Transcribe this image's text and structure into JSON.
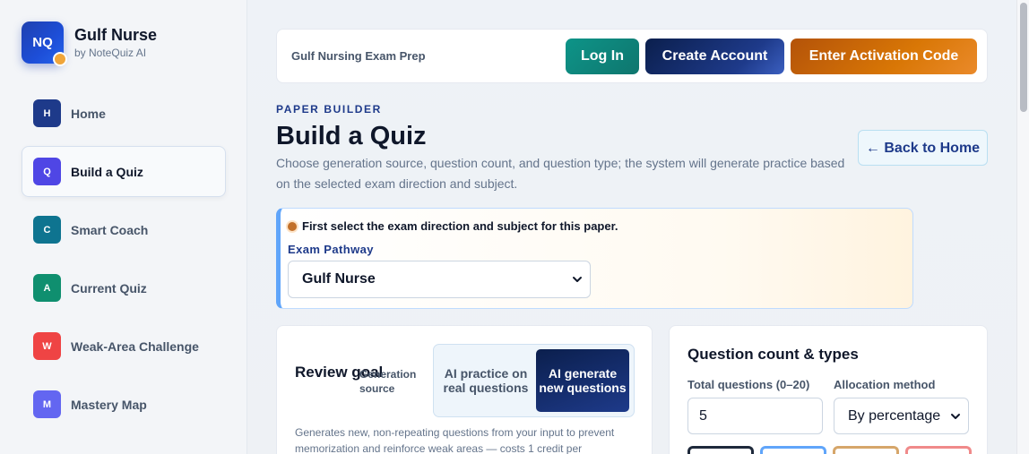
{
  "brand": {
    "logo_text": "NQ",
    "title": "Gulf Nurse",
    "subtitle": "by NoteQuiz AI"
  },
  "sidebar": {
    "items": [
      {
        "badge": "H",
        "label": "Home",
        "color": "#1e3a8a",
        "active": false
      },
      {
        "badge": "Q",
        "label": "Build a Quiz",
        "color": "#4f46e5",
        "active": true
      },
      {
        "badge": "C",
        "label": "Smart Coach",
        "color": "#0e7490",
        "active": false
      },
      {
        "badge": "A",
        "label": "Current Quiz",
        "color": "#0f8f6f",
        "active": false
      },
      {
        "badge": "W",
        "label": "Weak-Area Challenge",
        "color": "#ef4444",
        "active": false
      },
      {
        "badge": "M",
        "label": "Mastery Map",
        "color": "#6366f1",
        "active": false
      }
    ]
  },
  "topbar": {
    "title": "Gulf Nursing Exam Prep",
    "login_label": "Log In",
    "create_label": "Create Account",
    "activate_label": "Enter Activation Code"
  },
  "header": {
    "eyebrow": "PAPER BUILDER",
    "title": "Build a Quiz",
    "description": "Choose generation source, question count, and question type; the system will generate practice based on the selected exam direction and subject.",
    "back_label": "← Back to Home"
  },
  "notice": {
    "text": "First select the exam direction and subject for this paper.",
    "pathway_label": "Exam Pathway",
    "pathway_value": "Gulf Nurse"
  },
  "review": {
    "title": "Review goal",
    "source_label": "Generation source",
    "option_real": "AI practice on real questions",
    "option_new": "AI generate new questions",
    "description": "Generates new, non-repeating questions from your input to prevent memorization and reinforce weak areas — costs 1 credit per"
  },
  "question_count": {
    "title": "Question count & types",
    "total_label": "Total questions (0–20)",
    "total_value": "5",
    "allocation_label": "Allocation method",
    "allocation_value": "By percentage"
  },
  "colors": {
    "chip_1": "#1e293b",
    "chip_2": "#60a5fa",
    "chip_3": "#d6a66a",
    "chip_4": "#f08a8a"
  }
}
